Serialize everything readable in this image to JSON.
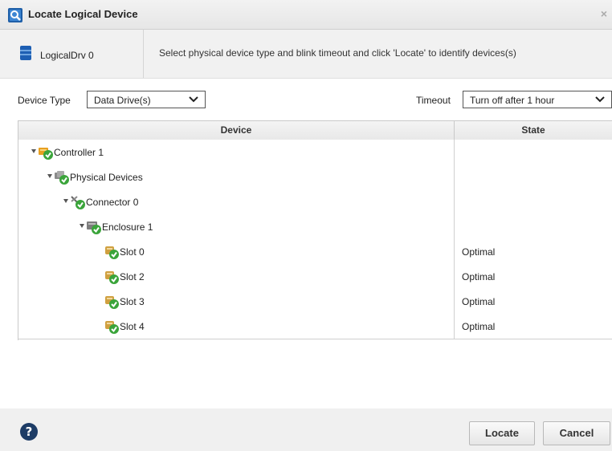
{
  "dialog": {
    "title": "Locate Logical Device",
    "close_glyph": "×"
  },
  "info": {
    "device_name": "LogicalDrv 0",
    "instruction": "Select physical device type and blink timeout and click 'Locate' to identify devices(s)"
  },
  "filters": {
    "device_type_label": "Device Type",
    "device_type_value": "Data Drive(s)",
    "timeout_label": "Timeout",
    "timeout_value": "Turn off after 1 hour"
  },
  "table": {
    "columns": [
      "Device",
      "State"
    ],
    "rows": [
      {
        "label": "Controller 1",
        "state": "",
        "expanded": true,
        "icon": "controller-icon"
      },
      {
        "label": "Physical Devices",
        "state": "",
        "expanded": true,
        "icon": "physical-devices-icon"
      },
      {
        "label": "Connector 0",
        "state": "",
        "expanded": true,
        "icon": "connector-icon"
      },
      {
        "label": "Enclosure 1",
        "state": "",
        "expanded": true,
        "icon": "enclosure-icon"
      },
      {
        "label": "Slot 0",
        "state": "Optimal",
        "expanded": false,
        "icon": "drive-icon"
      },
      {
        "label": "Slot 2",
        "state": "Optimal",
        "expanded": false,
        "icon": "drive-icon"
      },
      {
        "label": "Slot 3",
        "state": "Optimal",
        "expanded": false,
        "icon": "drive-icon"
      },
      {
        "label": "Slot 4",
        "state": "Optimal",
        "expanded": false,
        "icon": "drive-icon"
      }
    ]
  },
  "buttons": {
    "locate": "Locate",
    "cancel": "Cancel"
  },
  "colors": {
    "status_ok": "#3aa43a",
    "accent_blue": "#2a6fb0"
  }
}
